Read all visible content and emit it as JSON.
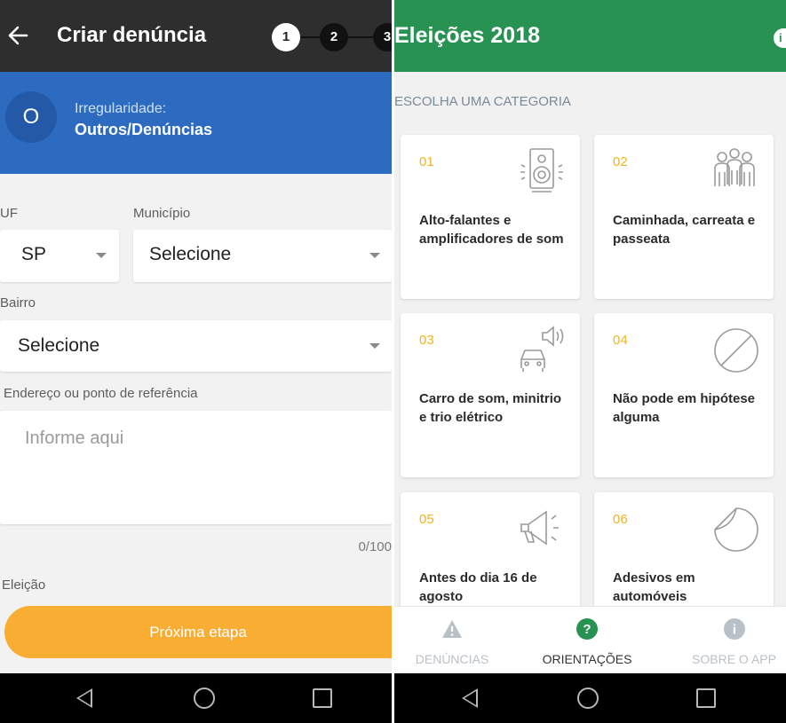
{
  "left_screen": {
    "appbar": {
      "title": "Criar denúncia",
      "steps": [
        "1",
        "2",
        "3"
      ]
    },
    "irregularity": {
      "avatar_letter": "O",
      "label": "Irregularidade:",
      "value": "Outros/Denúncias"
    },
    "form": {
      "uf_label": "UF",
      "uf_value": "SP",
      "municipio_label": "Município",
      "municipio_value": "Selecione",
      "bairro_label": "Bairro",
      "bairro_value": "Selecione",
      "endereco_label": "Endereço ou ponto de referência",
      "endereco_placeholder": "Informe aqui",
      "char_count": "0/100",
      "eleicao_label": "Eleição"
    },
    "next_button": "Próxima etapa"
  },
  "right_screen": {
    "appbar": {
      "title": "Eleições 2018",
      "info_icon": "info-icon"
    },
    "category_heading": "ESCOLHA UMA CATEGORIA",
    "categories": [
      {
        "number": "01",
        "title": "Alto-falantes e amplificadores de som",
        "icon": "speaker-icon"
      },
      {
        "number": "02",
        "title": "Caminhada, carreata e passeata",
        "icon": "people-group-icon"
      },
      {
        "number": "03",
        "title": "Carro de som, minitrio e trio elétrico",
        "icon": "car-speaker-icon"
      },
      {
        "number": "04",
        "title": "Não pode em hipótese alguma",
        "icon": "prohibited-icon"
      },
      {
        "number": "05",
        "title": "Antes do dia 16 de agosto",
        "icon": "megaphone-icon"
      },
      {
        "number": "06",
        "title": "Adesivos em automóveis",
        "icon": "sticker-icon"
      }
    ],
    "bottom_nav": [
      {
        "label": "DENÚNCIAS",
        "icon": "warning-icon",
        "active": false
      },
      {
        "label": "ORIENTAÇÕES",
        "icon": "help-icon",
        "active": true
      },
      {
        "label": "SOBRE O APP",
        "icon": "info-icon",
        "active": false
      }
    ]
  },
  "colors": {
    "left_appbar": "#2e2e2e",
    "right_appbar": "#279252",
    "irregularity_banner": "#2c6bc0",
    "primary_button": "#f9ad33",
    "category_number": "#f0b422",
    "nav_active": "#279252",
    "nav_inactive": "#b9c1c8"
  }
}
